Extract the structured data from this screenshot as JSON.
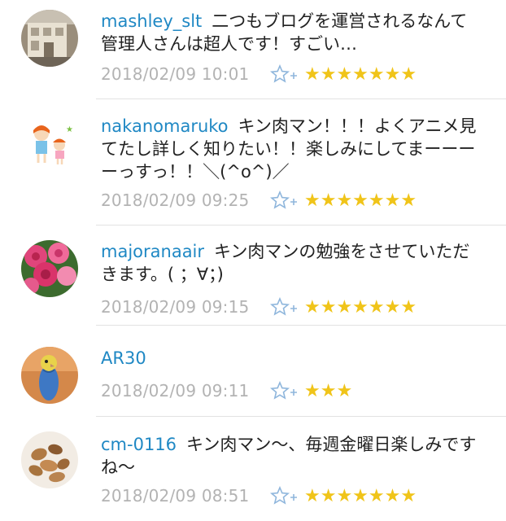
{
  "comments": [
    {
      "username": "mashley_slt",
      "text": "二つもブログを運営されるなんて管理人さんは超人です！すごい…",
      "date": "2018/02/09 10:01",
      "stars": "★★★★★★★",
      "avatar_icon": "house-photo-icon"
    },
    {
      "username": "nakanomaruko",
      "text": "キン肉マン！！！よくアニメ見てたし詳しく知りたい！！楽しみにしてまーーーーっすっ！！＼(^o^)／",
      "date": "2018/02/09 09:25",
      "stars": "★★★★★★★",
      "avatar_icon": "kids-illustration-icon"
    },
    {
      "username": "majoranaair",
      "text": "キン肉マンの勉強をさせていただきます。( ；∀；)",
      "date": "2018/02/09 09:15",
      "stars": "★★★★★★★",
      "avatar_icon": "roses-photo-icon"
    },
    {
      "username": "AR30",
      "text": "",
      "date": "2018/02/09 09:11",
      "stars": "★★★",
      "avatar_icon": "parakeet-photo-icon"
    },
    {
      "username": "cm-0116",
      "text": "キン肉マン〜、毎週金曜日楽しみですね〜",
      "date": "2018/02/09 08:51",
      "stars": "★★★★★★★",
      "avatar_icon": "nuts-photo-icon"
    }
  ],
  "colors": {
    "username": "#1f88c4",
    "star": "#f0c419",
    "date": "#b3b3b3",
    "add_star": "#8fb6dc"
  }
}
